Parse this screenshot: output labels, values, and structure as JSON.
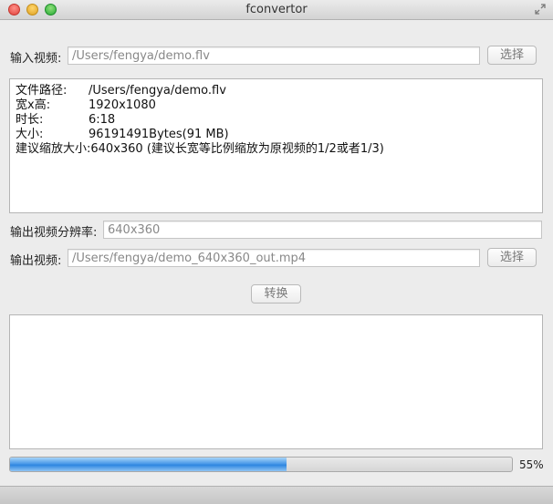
{
  "window": {
    "title": "fconvertor"
  },
  "input_video": {
    "label": "输入视频:",
    "value": "/Users/fengya/demo.flv",
    "choose_label": "选择"
  },
  "info": {
    "rows": [
      {
        "key": "文件路径:",
        "value": "/Users/fengya/demo.flv"
      },
      {
        "key": "宽x高:",
        "value": "1920x1080"
      },
      {
        "key": "时长:",
        "value": "6:18"
      },
      {
        "key": "大小:",
        "value": "96191491Bytes(91 MB)"
      }
    ],
    "suggestion": "建议缩放大小:640x360  (建议长宽等比例缩放为原视频的1/2或者1/3)"
  },
  "output_resolution": {
    "label": "输出视频分辨率:",
    "value": "640x360"
  },
  "output_video": {
    "label": "输出视频:",
    "value": "/Users/fengya/demo_640x360_out.mp4",
    "choose_label": "选择"
  },
  "convert_label": "转换",
  "progress": {
    "fraction": 0.55,
    "label": "55%",
    "color": "#3b8ee5"
  }
}
